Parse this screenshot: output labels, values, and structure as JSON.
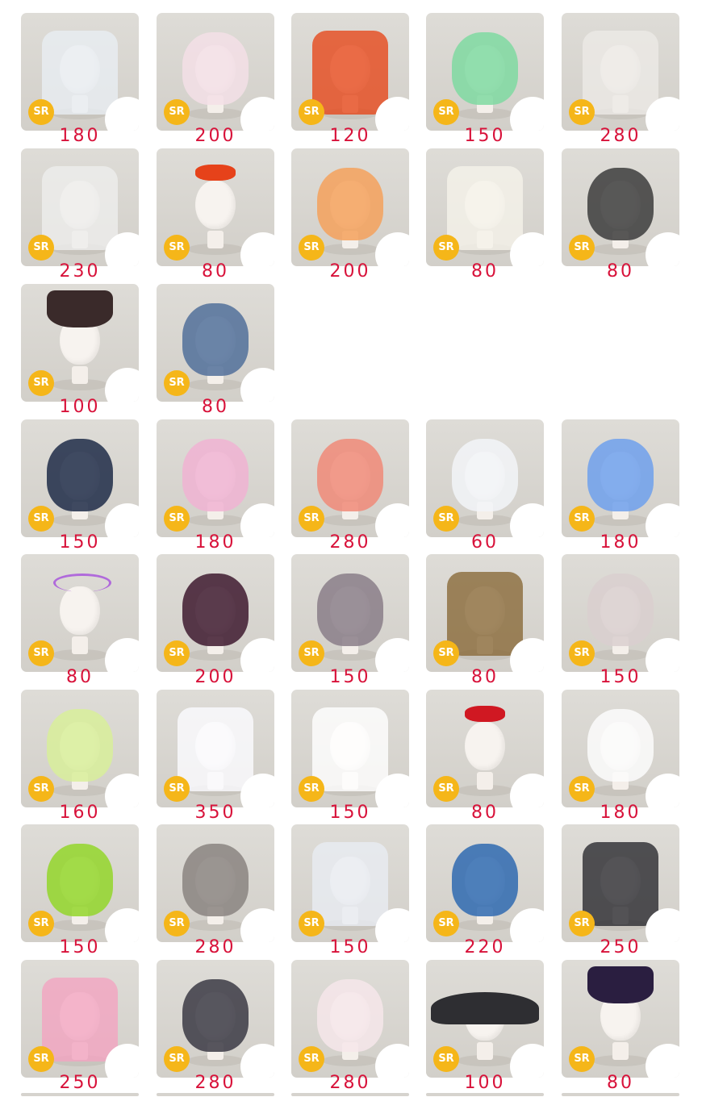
{
  "badge_label": "SR",
  "accent": {
    "price": "#d8123a",
    "badge": "#f5b619",
    "tile": "#d6d3ce"
  },
  "items": [
    {
      "price": "180",
      "icon": "hoodie-icon",
      "color": "#e8eef2"
    },
    {
      "price": "200",
      "icon": "hair-icon",
      "color": "#f3dfe6"
    },
    {
      "price": "120",
      "icon": "robe-icon",
      "color": "#e6491c"
    },
    {
      "price": "150",
      "icon": "hair-icon",
      "color": "#7fd9a1"
    },
    {
      "price": "280",
      "icon": "gown-icon",
      "color": "#eceae6"
    },
    {
      "price": "230",
      "icon": "veil-icon",
      "color": "#eeeeec"
    },
    {
      "price": "80",
      "icon": "bow-icon",
      "color": "#e6421a"
    },
    {
      "price": "200",
      "icon": "hair-icon",
      "color": "#f4a15c"
    },
    {
      "price": "80",
      "icon": "cape-icon",
      "color": "#f5f2ea"
    },
    {
      "price": "80",
      "icon": "hair-icon",
      "color": "#3c3c3c"
    },
    {
      "price": "100",
      "icon": "top-hat-icon",
      "color": "#3a2a2a"
    },
    {
      "price": "80",
      "icon": "hair-icon",
      "color": "#51709a"
    },
    {
      "price": "150",
      "icon": "hair-icon",
      "color": "#1f2b48"
    },
    {
      "price": "180",
      "icon": "hair-icon",
      "color": "#f0b3d2"
    },
    {
      "price": "280",
      "icon": "hair-icon",
      "color": "#f08a78"
    },
    {
      "price": "60",
      "icon": "hair-icon",
      "color": "#f2f4f8"
    },
    {
      "price": "180",
      "icon": "hair-icon",
      "color": "#6fa0ec"
    },
    {
      "price": "80",
      "icon": "headband-icon",
      "color": "#b06adb"
    },
    {
      "price": "200",
      "icon": "hair-icon",
      "color": "#3e1a2f"
    },
    {
      "price": "150",
      "icon": "hair-icon",
      "color": "#8a7e88"
    },
    {
      "price": "80",
      "icon": "bear-costume-icon",
      "color": "#8a6a3a"
    },
    {
      "price": "150",
      "icon": "hair-icon",
      "color": "#d9cfcf"
    },
    {
      "price": "160",
      "icon": "hair-icon",
      "color": "#d8ef9a"
    },
    {
      "price": "350",
      "icon": "bunny-hood-icon",
      "color": "#fbfbff"
    },
    {
      "price": "150",
      "icon": "kitty-plush-icon",
      "color": "#ffffff"
    },
    {
      "price": "80",
      "icon": "bow-icon",
      "color": "#d01822"
    },
    {
      "price": "180",
      "icon": "cat-ear-hair-icon",
      "color": "#fbfbfb"
    },
    {
      "price": "150",
      "icon": "hair-icon",
      "color": "#93d62a"
    },
    {
      "price": "280",
      "icon": "hair-icon",
      "color": "#8a8480"
    },
    {
      "price": "150",
      "icon": "ghost-sheet-icon",
      "color": "#e9ecf2"
    },
    {
      "price": "220",
      "icon": "hair-icon",
      "color": "#2f6ab0"
    },
    {
      "price": "250",
      "icon": "kuromi-plush-icon",
      "color": "#2a2a30"
    },
    {
      "price": "250",
      "icon": "melody-plush-icon",
      "color": "#f2a4c0"
    },
    {
      "price": "280",
      "icon": "hair-icon",
      "color": "#3b3a44"
    },
    {
      "price": "280",
      "icon": "hair-icon",
      "color": "#f6e6ea"
    },
    {
      "price": "100",
      "icon": "bat-wings-icon",
      "color": "#2e2e32"
    },
    {
      "price": "80",
      "icon": "witch-hat-icon",
      "color": "#2a1e40"
    }
  ]
}
